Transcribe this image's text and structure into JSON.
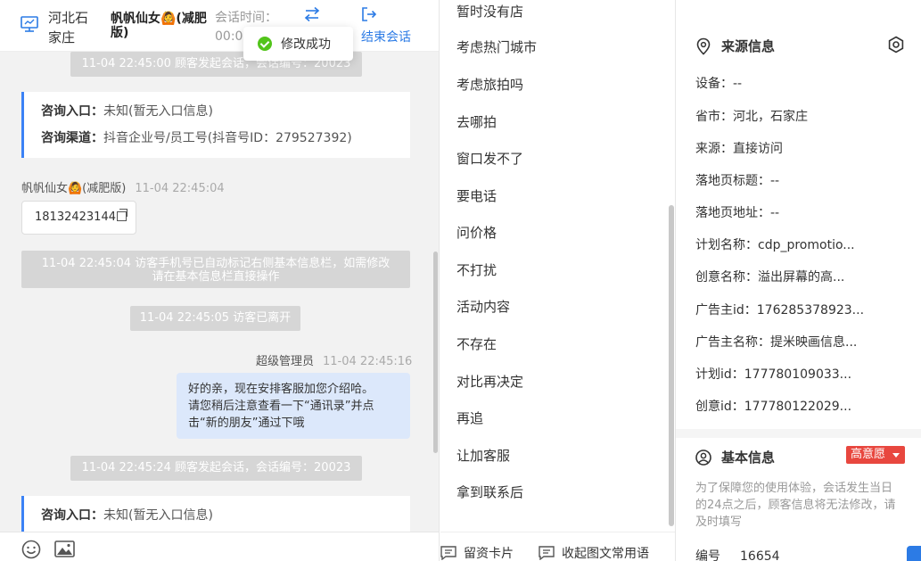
{
  "header": {
    "location": "河北石家庄",
    "username": "帆帆仙女🙆(减肥版)",
    "session_time_label": "会话时间：",
    "session_time_value": "00:0",
    "end_button": "结束会话"
  },
  "toast": {
    "text": "修改成功"
  },
  "chat": {
    "sys_top": "11-04 22:45:00 顾客发起会话，会话编号：20023",
    "card1": {
      "entry_label": "咨询入口：",
      "entry_value": "未知(暂无入口信息)",
      "channel_label": "咨询渠道：",
      "channel_value": "抖音企业号/员工号(抖音号ID：279527392)"
    },
    "visitor_name": "帆帆仙女🙆(减肥版)",
    "visitor_time": "11-04 22:45:04",
    "phone": "18132423144",
    "sys_phone_line1": "11-04 22:45:04 访客手机号已自动标记右侧基本信息栏，如需修改",
    "sys_phone_line2": "请在基本信息栏直接操作",
    "sys_left": "11-04 22:45:05 访客已离开",
    "agent_name": "超级管理员",
    "agent_time": "11-04 22:45:16",
    "agent_msg_line1": "好的亲，现在安排客服加您介绍哈。",
    "agent_msg_line2": "请您稍后注意查看一下“通讯录”并点",
    "agent_msg_line3": "击“新的朋友”通过下哦",
    "sys_second": "11-04 22:45:24 顾客发起会话，会话编号：20023",
    "card2": {
      "entry_label": "咨询入口：",
      "entry_value": "未知(暂无入口信息)"
    }
  },
  "replies": {
    "items": [
      "暂时没有店",
      "考虑热门城市",
      "考虑旅拍吗",
      "去哪拍",
      "窗口发不了",
      "要电话",
      "问价格",
      "不打扰",
      "活动内容",
      "不存在",
      "对比再决定",
      "再追",
      "让加客服",
      "拿到联系后"
    ],
    "footer_card": "留资卡片",
    "footer_collapse": "收起图文常用语"
  },
  "info": {
    "source_title": "来源信息",
    "fields": [
      "设备：--",
      "省市：河北，石家庄",
      "来源：直接访问",
      "落地页标题：--",
      "落地页地址：--",
      "计划名称：cdp_promotio...",
      "创意名称：溢出屏幕的高...",
      "广告主id：176285378923...",
      "广告主名称：提米映画信息...",
      "计划id：177780109033...",
      "创意id：177780122029..."
    ],
    "basic_title": "基本信息",
    "badge": "高意愿",
    "note": "为了保障您的使用体验，会话发生当日的24点之后，顾客信息将无法修改，请及时填写",
    "number_label": "编号",
    "number_value": "16654"
  },
  "colors": {
    "accent": "#2c7be5",
    "success": "#52c41a",
    "danger": "#e8473f",
    "card_border": "#3b82f6",
    "agent_bubble": "#dce8fb"
  }
}
